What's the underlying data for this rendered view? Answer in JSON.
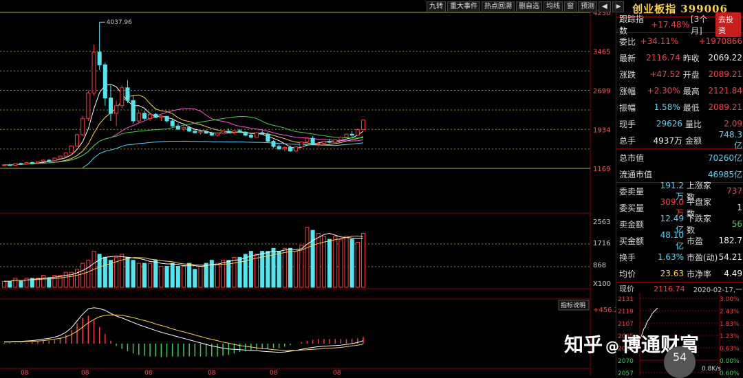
{
  "toolbar": {
    "buttons": [
      "九转",
      "重大事件",
      "热点回溯",
      "删自选",
      "均线",
      "窗",
      "预测"
    ],
    "prev_label": "◀",
    "next_label": "▶"
  },
  "price_axis": {
    "labels": [
      "4230",
      "3465",
      "2699",
      "1934",
      "1169"
    ]
  },
  "peak_label": "4037.96",
  "volume_axis": {
    "labels": [
      "2563",
      "1716",
      "868",
      "X100"
    ]
  },
  "macd": {
    "indicator_btn": "指标说明",
    "value": "+456.2"
  },
  "x_axis": {
    "labels": [
      "08",
      "08",
      "08",
      "08",
      "08",
      "08"
    ]
  },
  "chart_data": {
    "type": "candlestick",
    "title": "创业板指 399006",
    "ylim": [
      1169,
      4230
    ],
    "candles": [
      [
        1230,
        1250,
        1210,
        1240
      ],
      [
        1240,
        1260,
        1225,
        1230
      ],
      [
        1230,
        1270,
        1220,
        1265
      ],
      [
        1265,
        1280,
        1245,
        1255
      ],
      [
        1255,
        1290,
        1250,
        1285
      ],
      [
        1285,
        1300,
        1270,
        1280
      ],
      [
        1280,
        1310,
        1275,
        1305
      ],
      [
        1305,
        1340,
        1295,
        1330
      ],
      [
        1330,
        1350,
        1310,
        1320
      ],
      [
        1320,
        1380,
        1315,
        1370
      ],
      [
        1370,
        1420,
        1360,
        1410
      ],
      [
        1410,
        1480,
        1400,
        1470
      ],
      [
        1470,
        1620,
        1460,
        1610
      ],
      [
        1610,
        1850,
        1600,
        1830
      ],
      [
        1830,
        2200,
        1800,
        2150
      ],
      [
        2150,
        2700,
        2100,
        2650
      ],
      [
        2650,
        3600,
        2600,
        3450
      ],
      [
        3450,
        4037.96,
        3100,
        3200
      ],
      [
        3200,
        3250,
        2400,
        2550
      ],
      [
        2550,
        2800,
        2100,
        2250
      ],
      [
        2250,
        2500,
        2000,
        2400
      ],
      [
        2400,
        2800,
        2350,
        2750
      ],
      [
        2750,
        2900,
        2450,
        2500
      ],
      [
        2500,
        2600,
        2050,
        2100
      ],
      [
        2100,
        2300,
        2050,
        2250
      ],
      [
        2250,
        2300,
        2120,
        2150
      ],
      [
        2150,
        2250,
        2100,
        2230
      ],
      [
        2230,
        2260,
        2150,
        2170
      ],
      [
        2170,
        2210,
        2100,
        2190
      ],
      [
        2190,
        2200,
        2080,
        2100
      ],
      [
        2100,
        2150,
        1980,
        2000
      ],
      [
        2000,
        2050,
        1920,
        1940
      ],
      [
        1940,
        1990,
        1900,
        1970
      ],
      [
        1970,
        2000,
        1880,
        1900
      ],
      [
        1900,
        1930,
        1850,
        1870
      ],
      [
        1870,
        1900,
        1830,
        1890
      ],
      [
        1890,
        1920,
        1850,
        1860
      ],
      [
        1860,
        1890,
        1800,
        1820
      ],
      [
        1820,
        1880,
        1800,
        1860
      ],
      [
        1860,
        1920,
        1840,
        1900
      ],
      [
        1900,
        1950,
        1860,
        1880
      ],
      [
        1880,
        1920,
        1840,
        1910
      ],
      [
        1910,
        1940,
        1870,
        1880
      ],
      [
        1880,
        1900,
        1800,
        1820
      ],
      [
        1820,
        1860,
        1760,
        1780
      ],
      [
        1780,
        1880,
        1770,
        1870
      ],
      [
        1870,
        1910,
        1830,
        1840
      ],
      [
        1840,
        1880,
        1680,
        1700
      ],
      [
        1700,
        1720,
        1570,
        1600
      ],
      [
        1600,
        1640,
        1530,
        1550
      ],
      [
        1550,
        1600,
        1500,
        1580
      ],
      [
        1580,
        1620,
        1490,
        1510
      ],
      [
        1510,
        1600,
        1495,
        1590
      ],
      [
        1590,
        1700,
        1580,
        1690
      ],
      [
        1690,
        1780,
        1680,
        1760
      ],
      [
        1760,
        1800,
        1620,
        1650
      ],
      [
        1650,
        1690,
        1600,
        1660
      ],
      [
        1660,
        1710,
        1630,
        1700
      ],
      [
        1700,
        1750,
        1660,
        1680
      ],
      [
        1680,
        1740,
        1670,
        1730
      ],
      [
        1730,
        1800,
        1700,
        1780
      ],
      [
        1780,
        1850,
        1760,
        1840
      ],
      [
        1840,
        1900,
        1790,
        1820
      ],
      [
        1820,
        1950,
        1810,
        1930
      ],
      [
        1930,
        2130,
        1920,
        2116.74
      ]
    ],
    "volume": [
      2,
      2,
      3,
      2,
      3,
      3,
      3,
      4,
      3,
      4,
      4,
      5,
      5,
      6,
      8,
      9,
      12,
      11,
      10,
      9,
      10,
      11,
      10,
      9,
      8,
      8,
      8,
      9,
      7,
      7,
      8,
      7,
      7,
      8,
      6,
      7,
      8,
      9,
      8,
      9,
      9,
      10,
      10,
      11,
      12,
      11,
      12,
      12,
      13,
      12,
      13,
      13,
      12,
      14,
      20,
      19,
      18,
      17,
      16,
      17,
      16,
      17,
      16,
      15,
      18
    ],
    "macd_dif": [
      0.05,
      0.05,
      0.06,
      0.06,
      0.07,
      0.08,
      0.1,
      0.12,
      0.14,
      0.17,
      0.22,
      0.3,
      0.42,
      0.6,
      0.78,
      0.92,
      0.95,
      0.93,
      0.88,
      0.8,
      0.73,
      0.68,
      0.62,
      0.56,
      0.5,
      0.45,
      0.4,
      0.35,
      0.3,
      0.26,
      0.22,
      0.18,
      0.14,
      0.1,
      0.06,
      0.02,
      -0.02,
      -0.06,
      -0.09,
      -0.12,
      -0.14,
      -0.15,
      -0.16,
      -0.17,
      -0.18,
      -0.19,
      -0.2,
      -0.21,
      -0.22,
      -0.23,
      -0.22,
      -0.2,
      -0.18,
      -0.15,
      -0.12,
      -0.1,
      -0.08,
      -0.07,
      -0.06,
      -0.05,
      -0.04,
      -0.02,
      0.0,
      0.03,
      0.08
    ],
    "macd_dea": [
      0.04,
      0.04,
      0.05,
      0.05,
      0.06,
      0.06,
      0.07,
      0.08,
      0.1,
      0.12,
      0.14,
      0.18,
      0.24,
      0.33,
      0.44,
      0.55,
      0.64,
      0.71,
      0.75,
      0.76,
      0.76,
      0.75,
      0.72,
      0.69,
      0.65,
      0.61,
      0.57,
      0.52,
      0.48,
      0.44,
      0.39,
      0.35,
      0.31,
      0.27,
      0.23,
      0.19,
      0.15,
      0.11,
      0.08,
      0.04,
      0.01,
      -0.02,
      -0.05,
      -0.07,
      -0.09,
      -0.11,
      -0.13,
      -0.14,
      -0.16,
      -0.17,
      -0.18,
      -0.18,
      -0.18,
      -0.17,
      -0.16,
      -0.15,
      -0.14,
      -0.13,
      -0.12,
      -0.11,
      -0.1,
      -0.08,
      -0.06,
      -0.04,
      -0.01
    ]
  },
  "panel": {
    "title": "创业板指 399006",
    "track": {
      "label": "跟踪指数",
      "value": "+17.48%",
      "period": "[3个月]",
      "button": "去投资"
    },
    "rows": [
      {
        "k1": "委比",
        "v1": "+34.11%",
        "c1": "red",
        "k2": "",
        "v2": "+1970866",
        "c2": "red"
      },
      {
        "k1": "最新",
        "v1": "2116.74",
        "c1": "red",
        "k2": "昨收",
        "v2": "2069.22",
        "c2": "white"
      },
      {
        "k1": "涨跌",
        "v1": "+47.52",
        "c1": "red",
        "k2": "开盘",
        "v2": "2089.21",
        "c2": "red"
      },
      {
        "k1": "涨幅",
        "v1": "+2.30%",
        "c1": "red",
        "k2": "最高",
        "v2": "2121.84",
        "c2": "red"
      },
      {
        "k1": "振幅",
        "v1": "1.58%",
        "c1": "cyan",
        "k2": "最低",
        "v2": "2089.21",
        "c2": "red"
      },
      {
        "k1": "现手",
        "v1": "29626",
        "c1": "cyan",
        "k2": "量比",
        "v2": "2.09",
        "c2": "red"
      },
      {
        "k1": "总手",
        "v1": "4937万",
        "c1": "white",
        "k2": "金额",
        "v2": "748.3亿",
        "c2": "cyan"
      }
    ],
    "mv_total": {
      "k": "总市值",
      "v": "70260亿"
    },
    "mv_float": {
      "k": "流通市值",
      "v": "46985亿"
    },
    "rows2": [
      {
        "k1": "委卖量",
        "v1": "191.2万",
        "c1": "cyan",
        "k2": "上涨家数",
        "v2": "737",
        "c2": "red"
      },
      {
        "k1": "委买量",
        "v1": "309.0万",
        "c1": "red",
        "k2": "平盘家数",
        "v2": "1",
        "c2": "white"
      },
      {
        "k1": "卖金额",
        "v1": "12.49亿",
        "c1": "cyan",
        "k2": "下跌家数",
        "v2": "56",
        "c2": "green"
      },
      {
        "k1": "买金额",
        "v1": "48.10亿",
        "c1": "cyan",
        "k2": "市盈",
        "v2": "182.7",
        "c2": "white"
      },
      {
        "k1": "换手",
        "v1": "1.63%",
        "c1": "cyan",
        "k2": "市盈(动)",
        "v2": "54.21",
        "c2": "white"
      },
      {
        "k1": "均价",
        "v1": "23.63",
        "c1": "yellow",
        "k2": "市净率",
        "v2": "4.49",
        "c2": "white"
      }
    ],
    "mini": {
      "label": "现价",
      "now": "2116.74",
      "date": "2020-02-17,一",
      "left_labels": [
        "2131",
        "2119",
        "2107",
        "2095",
        "2082",
        "2070",
        "2057"
      ],
      "right_labels": [
        "3.00%",
        "2.43%",
        "1.83%",
        "1.23%",
        "0.63%",
        "0.00%",
        "0.60%"
      ]
    }
  },
  "watermark": {
    "brand": "知乎",
    "at": "@",
    "name": "博通财富"
  },
  "badge": {
    "value": "54"
  },
  "speed": {
    "value": "0.8K/s"
  }
}
